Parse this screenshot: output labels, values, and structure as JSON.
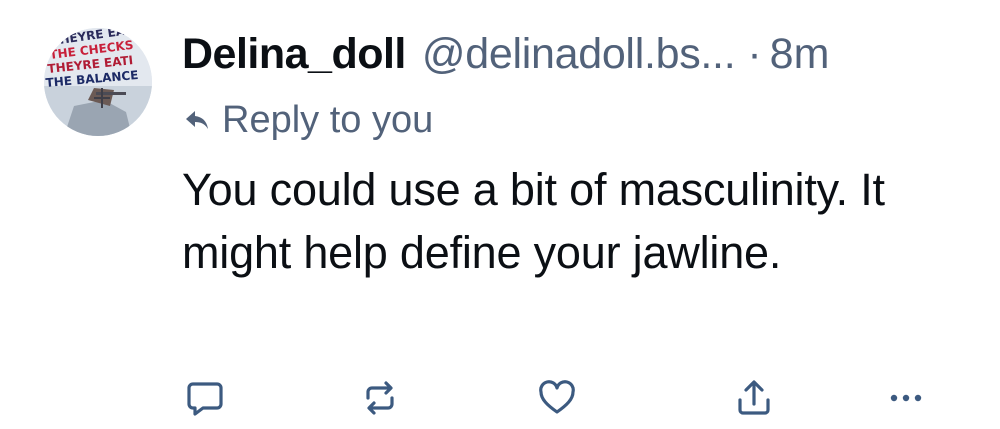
{
  "post": {
    "author": {
      "display_name": "Delina_doll",
      "handle": "@delinadoll.bs...",
      "separator": "·",
      "time": "8m",
      "avatar_text": [
        "THEYRE EAT",
        "THE CHECKS",
        "THEYRE EATI",
        "THE BALANCE"
      ]
    },
    "reply_label": "Reply to you",
    "text": "You could use a bit of masculinity. It might help define your jawline."
  },
  "actions": {
    "reply_icon": "comment-icon",
    "repost_icon": "repost-icon",
    "like_icon": "heart-icon",
    "share_icon": "share-icon",
    "more_icon": "more-icon"
  },
  "colors": {
    "text": "#0b0f14",
    "muted": "#52627a",
    "icon": "#3c5a80",
    "background": "#ffffff"
  }
}
